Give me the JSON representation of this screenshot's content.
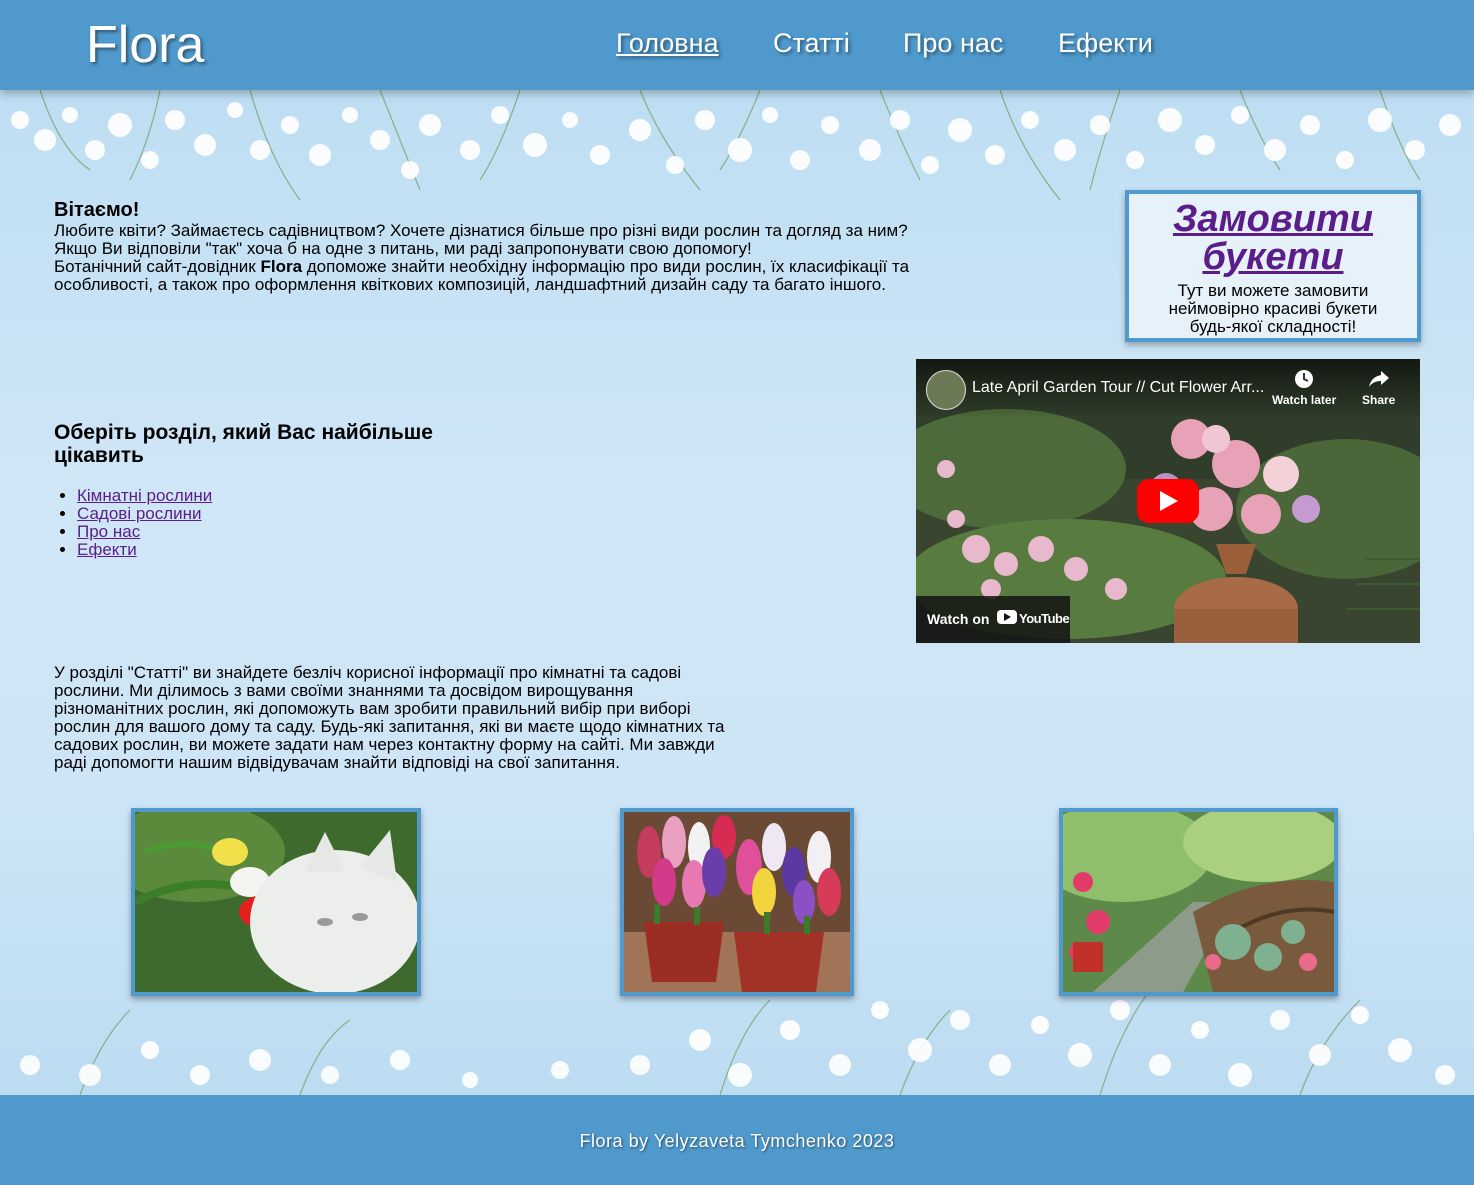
{
  "header": {
    "logo": "Flora",
    "nav": [
      {
        "label": "Головна",
        "active": true
      },
      {
        "label": "Статті",
        "active": false
      },
      {
        "label": "Про нас",
        "active": false
      },
      {
        "label": "Ефекти",
        "active": false
      }
    ]
  },
  "welcome": {
    "title": "Вітаємо!",
    "line1": "Любите квіти? Займаєтесь садівництвом? Хочете дізнатися більше про різні види рослин та догляд за ним?",
    "line2": "Якщо Ви відповіли \"так\" хоча б на одне з питань, ми раді запропонувати свою допомогу!",
    "line3_before": "Ботанічний сайт-довідник ",
    "line3_bold": "Flora",
    "line3_after": " допоможе знайти необхідну інформацію про види рослин, їх класифікації та особливості, а також про оформлення квіткових композицій, ландшафтний дизайн саду та багато іншого."
  },
  "order": {
    "link": "Замовити букети",
    "text": "Тут ви можете замовити неймовірно красиві букети будь-якої складності!"
  },
  "video": {
    "title": "Late April Garden Tour // Cut Flower Arr...",
    "watch_later": "Watch later",
    "share": "Share",
    "watch_on": "Watch on",
    "youtube": "YouTube"
  },
  "sections": {
    "title": "Оберіть розділ, який Вас найбільше цікавить",
    "items": [
      "Кімнатні рослини",
      "Садові рослини",
      "Про нас",
      "Ефекти"
    ]
  },
  "articles": {
    "text": "У розділі \"Статті\" ви знайдете безліч корисної інформації про кімнатні та садові рослини. Ми ділимось з вами своїми знаннями та досвідом вирощування різноманітних рослин, які допоможуть вам зробити правильний вибір при виборі рослин для вашого дому та саду. Будь-які запитання, які ви маєте щодо кімнатних та садових рослин, ви можете задати нам через контактну форму на сайті. Ми завжди раді допомогти нашим відвідувачам знайти відповіді на свої запитання."
  },
  "footer": {
    "text": "Flora by Yelyzaveta Tymchenko 2023"
  },
  "colors": {
    "header_bg": "#4f99cc",
    "link_purple": "#5b1d8a",
    "page_bg": "#c9e3f5"
  }
}
